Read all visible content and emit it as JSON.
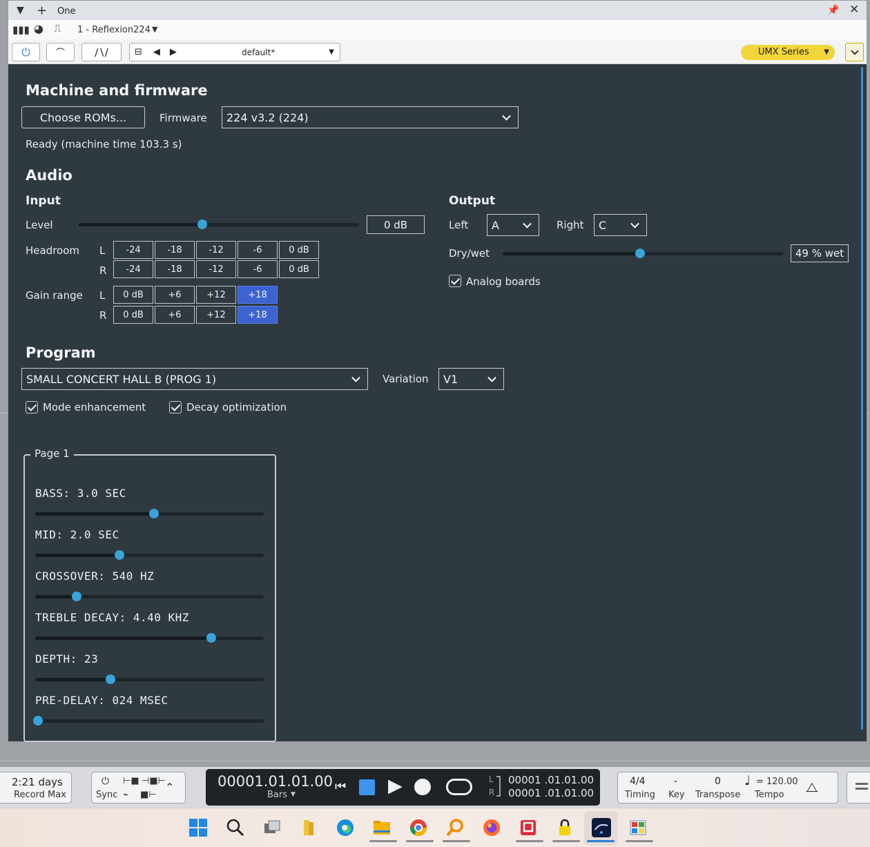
{
  "window": {
    "song_title": "One",
    "track_label": "1 - Reflexion224",
    "preset": "default*",
    "series": "UMX Series"
  },
  "machine": {
    "heading": "Machine and firmware",
    "choose_roms": "Choose ROMs...",
    "firmware_label": "Firmware",
    "firmware_value": "224 v3.2 (224)",
    "status": "Ready  (machine time 103.3 s)"
  },
  "audio": {
    "heading": "Audio",
    "input": {
      "heading": "Input",
      "level_label": "Level",
      "level_value": "0 dB",
      "level_fraction": 0.44,
      "headroom_label": "Headroom",
      "gain_label": "Gain range",
      "ch_l": "L",
      "ch_r": "R",
      "headroom_options": [
        "-24",
        "-18",
        "-12",
        "-6",
        "0 dB"
      ],
      "gain_options": [
        "0 dB",
        "+6",
        "+12",
        "+18"
      ],
      "gain_selected": "+18"
    },
    "output": {
      "heading": "Output",
      "left_label": "Left",
      "left_value": "A",
      "right_label": "Right",
      "right_value": "C",
      "drywet_label": "Dry/wet",
      "drywet_value": "49 % wet",
      "drywet_fraction": 0.49,
      "analog_boards": "Analog boards",
      "analog_boards_checked": true
    }
  },
  "program": {
    "heading": "Program",
    "selected": "SMALL CONCERT HALL B (PROG 1)",
    "variation_label": "Variation",
    "variation_value": "V1",
    "mode_enhancement": "Mode enhancement",
    "mode_enhancement_checked": true,
    "decay_optimization": "Decay optimization",
    "decay_optimization_checked": true
  },
  "page": {
    "legend": "Page 1",
    "params": [
      {
        "label": "BASS: 3.0 SEC",
        "fraction": 0.52
      },
      {
        "label": "MID: 2.0 SEC",
        "fraction": 0.37
      },
      {
        "label": "CROSSOVER: 540 HZ",
        "fraction": 0.18
      },
      {
        "label": "TREBLE DECAY: 4.40 KHZ",
        "fraction": 0.77
      },
      {
        "label": "DEPTH: 23",
        "fraction": 0.33
      },
      {
        "label": "PRE-DELAY: 024 MSEC",
        "fraction": 0.0
      }
    ]
  },
  "transport": {
    "record_time": "2:21 days",
    "record_label": "Record Max",
    "sync_label": "Sync",
    "position": "00001.01.01.00",
    "position_unit": "Bars",
    "loop_l": "00001 .01.01.00",
    "loop_r": "00001 .01.01.00",
    "loop_l_label": "L",
    "loop_r_label": "R",
    "timing_value": "4/4",
    "timing_label": "Timing",
    "key_value": "-",
    "key_label": "Key",
    "transpose_value": "0",
    "transpose_label": "Transpose",
    "tempo_value": "= 120.00",
    "tempo_label": "Tempo"
  },
  "colors": {
    "editor_bg": "#2f3940",
    "accent": "#3aa3d8",
    "selected_cell": "#3d63d1",
    "series_badge": "#f1d53a"
  }
}
